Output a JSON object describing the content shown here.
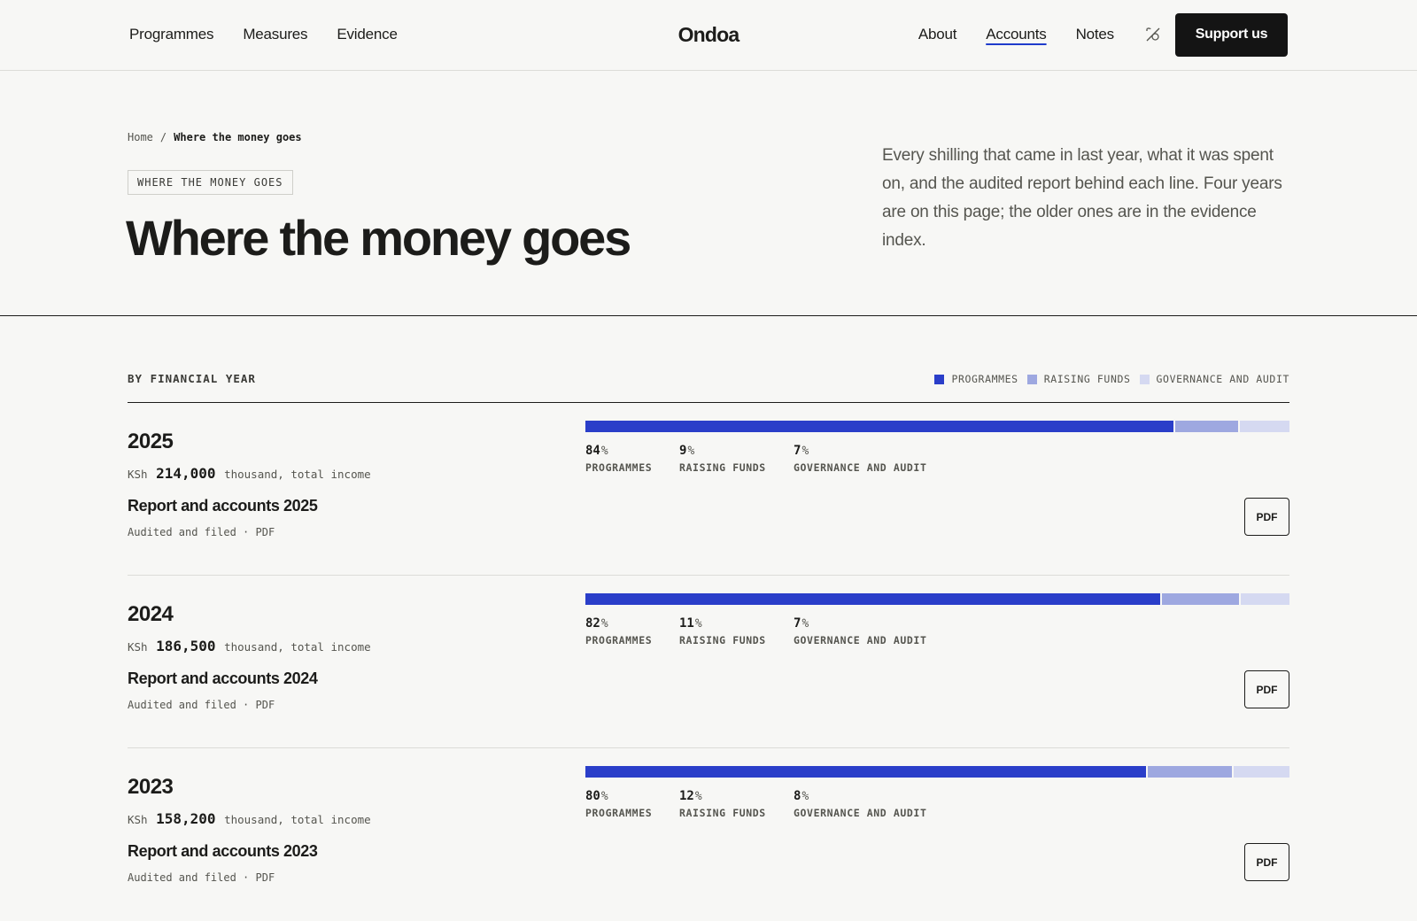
{
  "header": {
    "nav_left": [
      "Programmes",
      "Measures",
      "Evidence"
    ],
    "brand": "Ondoa",
    "nav_right": [
      "About",
      "Accounts",
      "Notes"
    ],
    "active_item": "Accounts",
    "theme_icon": "contrast-toggle-icon",
    "support_label": "Support us"
  },
  "breadcrumb": {
    "home": "Home",
    "separator": "/",
    "current": "Where the money goes"
  },
  "hero": {
    "eyebrow": "WHERE THE MONEY GOES",
    "title": "Where the money goes",
    "intro": "Every shilling that came in last year, what it was spent on, and the audited report behind each line. Four years are on this page; the older ones are in the evidence index."
  },
  "section": {
    "title": "BY FINANCIAL YEAR",
    "legend": [
      {
        "label": "PROGRAMMES",
        "color": "#2a3ec9"
      },
      {
        "label": "RAISING FUNDS",
        "color": "#9ea8e0"
      },
      {
        "label": "GOVERNANCE AND AUDIT",
        "color": "#d5d9f1"
      }
    ]
  },
  "years": [
    {
      "year": "2025",
      "currency": "KSh",
      "amount": "214,000",
      "unit": "thousand, total income",
      "report_title": "Report and accounts 2025",
      "report_meta": "Audited and filed · PDF",
      "pdf_label": "PDF",
      "split": [
        {
          "value": "84",
          "label": "PROGRAMMES"
        },
        {
          "value": "9",
          "label": "RAISING FUNDS"
        },
        {
          "value": "7",
          "label": "GOVERNANCE AND AUDIT"
        }
      ]
    },
    {
      "year": "2024",
      "currency": "KSh",
      "amount": "186,500",
      "unit": "thousand, total income",
      "report_title": "Report and accounts 2024",
      "report_meta": "Audited and filed · PDF",
      "pdf_label": "PDF",
      "split": [
        {
          "value": "82",
          "label": "PROGRAMMES"
        },
        {
          "value": "11",
          "label": "RAISING FUNDS"
        },
        {
          "value": "7",
          "label": "GOVERNANCE AND AUDIT"
        }
      ]
    },
    {
      "year": "2023",
      "currency": "KSh",
      "amount": "158,200",
      "unit": "thousand, total income",
      "report_title": "Report and accounts 2023",
      "report_meta": "Audited and filed · PDF",
      "pdf_label": "PDF",
      "split": [
        {
          "value": "80",
          "label": "PROGRAMMES"
        },
        {
          "value": "12",
          "label": "RAISING FUNDS"
        },
        {
          "value": "8",
          "label": "GOVERNANCE AND AUDIT"
        }
      ]
    }
  ],
  "pct_symbol": "%"
}
